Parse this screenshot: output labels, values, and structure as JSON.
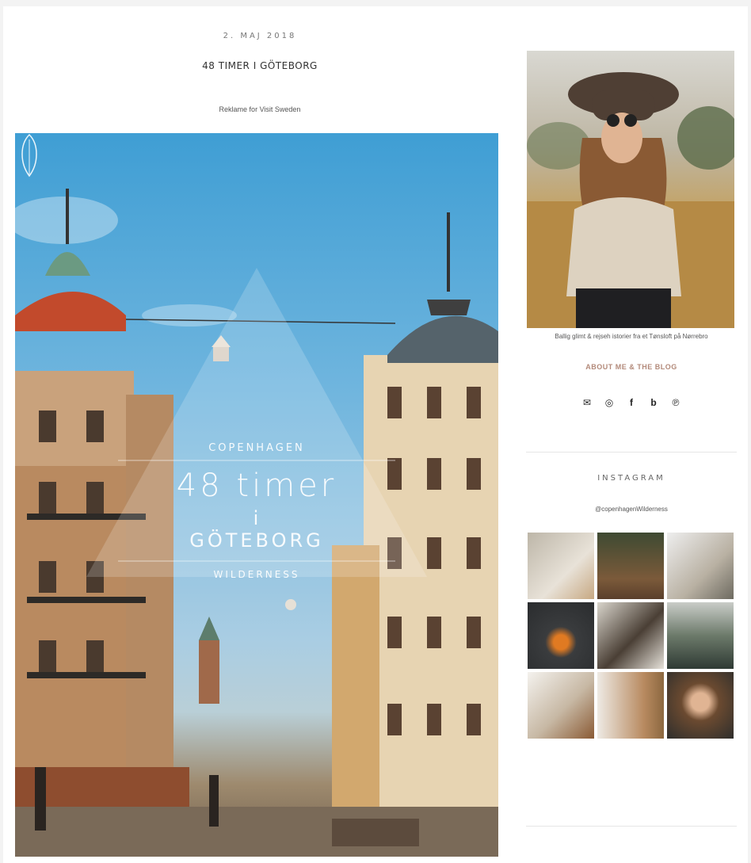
{
  "post": {
    "date": "2. MAJ 2018",
    "title": "48 TIMER I GÖTEBORG",
    "sponsor": "Reklame for Visit Sweden"
  },
  "hero": {
    "city": "COPENHAGEN",
    "line1": "48 timer",
    "line2": "i",
    "line3": "GÖTEBORG",
    "brand": "WILDERNESS"
  },
  "sidebar": {
    "caption": "Ballig glimt & rejseh istorier fra et Tønsloft på Nørrebro",
    "about_label": "ABOUT ME & THE BLOG",
    "social": [
      {
        "name": "email-icon",
        "glyph": "✉"
      },
      {
        "name": "instagram-icon",
        "glyph": "◎"
      },
      {
        "name": "facebook-icon",
        "glyph": "f"
      },
      {
        "name": "bloglovin-icon",
        "glyph": "b"
      },
      {
        "name": "pinterest-icon",
        "glyph": "℗"
      }
    ],
    "instagram_title": "INSTAGRAM",
    "instagram_handle": "@copenhagenWilderness"
  },
  "colors": {
    "accent": "#b38a7a",
    "sky": "#3f9ed4"
  }
}
